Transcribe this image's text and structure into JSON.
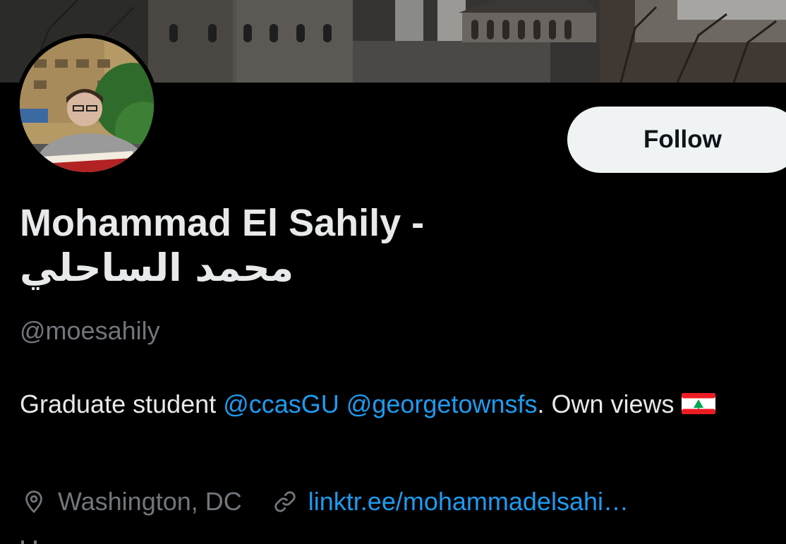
{
  "profile": {
    "name_line1": "Mohammad El Sahily -",
    "name_line2": "محمد الساحلي",
    "handle": "@moesahily",
    "bio": {
      "text_before": "Graduate student ",
      "mention1": "@ccasGU",
      "between": " ",
      "mention2": "@georgetownsfs",
      "text_after": ". Own views",
      "flag": "lebanon-flag"
    },
    "location": "Washington, DC",
    "link": "linktr.ee/mohammadelsahi…"
  },
  "actions": {
    "follow_label": "Follow"
  },
  "icons": {
    "location": "location-pin-icon",
    "link": "link-icon"
  },
  "colors": {
    "background": "#000000",
    "primary_text": "#e7e9ea",
    "secondary_text": "#71767b",
    "link": "#1d9bf0",
    "follow_bg": "#eff3f4"
  }
}
